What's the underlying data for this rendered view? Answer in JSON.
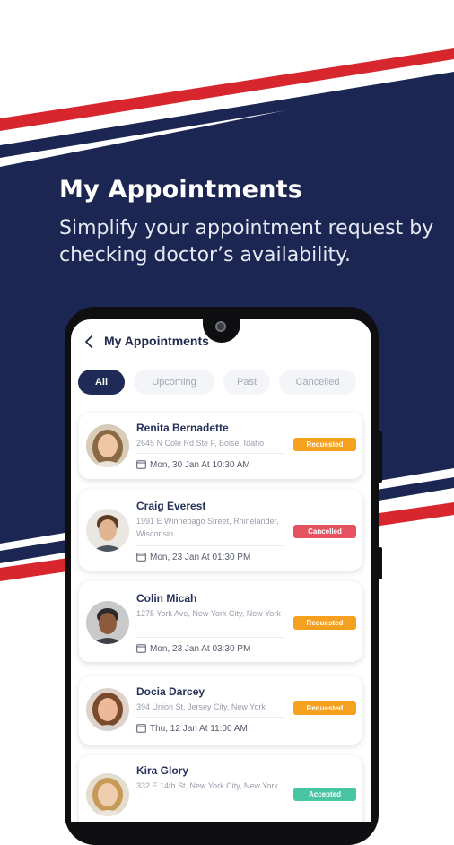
{
  "colors": {
    "navy": "#1b2652",
    "stripe_red": "#d8262e",
    "requested": "#f5a01f",
    "cancelled": "#e55361",
    "accepted": "#48c5a2"
  },
  "promo": {
    "headline": "My Appointments",
    "subline": "Simplify your appointment request by checking doctor’s availability."
  },
  "app": {
    "title": "My Appointments",
    "back_icon": "chevron-left-icon",
    "tabs": [
      {
        "label": "All",
        "active": true
      },
      {
        "label": "Upcoming",
        "active": false
      },
      {
        "label": "Past",
        "active": false
      },
      {
        "label": "Cancelled",
        "active": false
      }
    ],
    "appointments": [
      {
        "name": "Renita Bernadette",
        "address": "2645 N Cole Rd Ste F, Boise, Idaho",
        "datetime": "Mon, 30 Jan At 10:30 AM",
        "status": "Requested"
      },
      {
        "name": "Craig Everest",
        "address": "1991 E Winnebago Street, Rhinelander, Wisconsin",
        "datetime": "Mon, 23 Jan At 01:30 PM",
        "status": "Cancelled"
      },
      {
        "name": "Colin Micah",
        "address": "1275 York Ave, New York City, New York",
        "datetime": "Mon, 23 Jan At 03:30 PM",
        "status": "Requested"
      },
      {
        "name": "Docia Darcey",
        "address": "394 Union St, Jersey City, New York",
        "datetime": "Thu, 12 Jan At 11:00 AM",
        "status": "Requested"
      },
      {
        "name": "Kira Glory",
        "address": "332 E 14th St, New York City, New York",
        "datetime": "",
        "status": "Accepted"
      }
    ]
  }
}
